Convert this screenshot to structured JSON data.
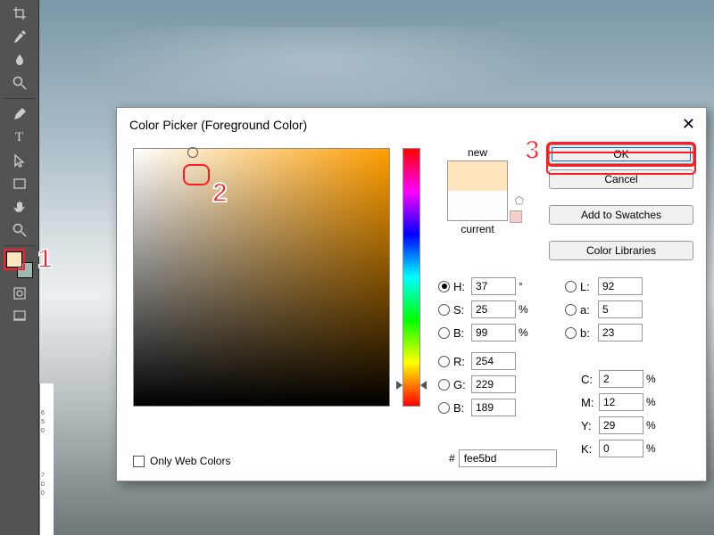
{
  "dialog": {
    "title": "Color Picker (Foreground Color)",
    "close": "✕",
    "new_label": "new",
    "current_label": "current",
    "buttons": {
      "ok": "OK",
      "cancel": "Cancel",
      "add": "Add to Swatches",
      "libs": "Color Libraries"
    },
    "fields": {
      "H": {
        "label": "H:",
        "value": "37",
        "unit": "°"
      },
      "S": {
        "label": "S:",
        "value": "25",
        "unit": "%"
      },
      "Bv": {
        "label": "B:",
        "value": "99",
        "unit": "%"
      },
      "R": {
        "label": "R:",
        "value": "254",
        "unit": ""
      },
      "G": {
        "label": "G:",
        "value": "229",
        "unit": ""
      },
      "Bb": {
        "label": "B:",
        "value": "189",
        "unit": ""
      },
      "L": {
        "label": "L:",
        "value": "92"
      },
      "a": {
        "label": "a:",
        "value": "5"
      },
      "b": {
        "label": "b:",
        "value": "23"
      },
      "C": {
        "label": "C:",
        "value": "2",
        "unit": "%"
      },
      "M": {
        "label": "M:",
        "value": "12",
        "unit": "%"
      },
      "Y": {
        "label": "Y:",
        "value": "29",
        "unit": "%"
      },
      "K": {
        "label": "K:",
        "value": "0",
        "unit": "%"
      }
    },
    "hex": {
      "prefix": "#",
      "value": "fee5bd"
    },
    "only_web": "Only Web Colors"
  },
  "annotations": {
    "one": "1",
    "two": "2",
    "three": "3"
  },
  "ruler": {
    "a": "6",
    "b": "5",
    "c": "0",
    "d": "7",
    "e": "0",
    "f": "0"
  },
  "colors": {
    "new": "#fee5bd",
    "current": "#fdfdfd",
    "accent_red": "#ff1a24"
  }
}
